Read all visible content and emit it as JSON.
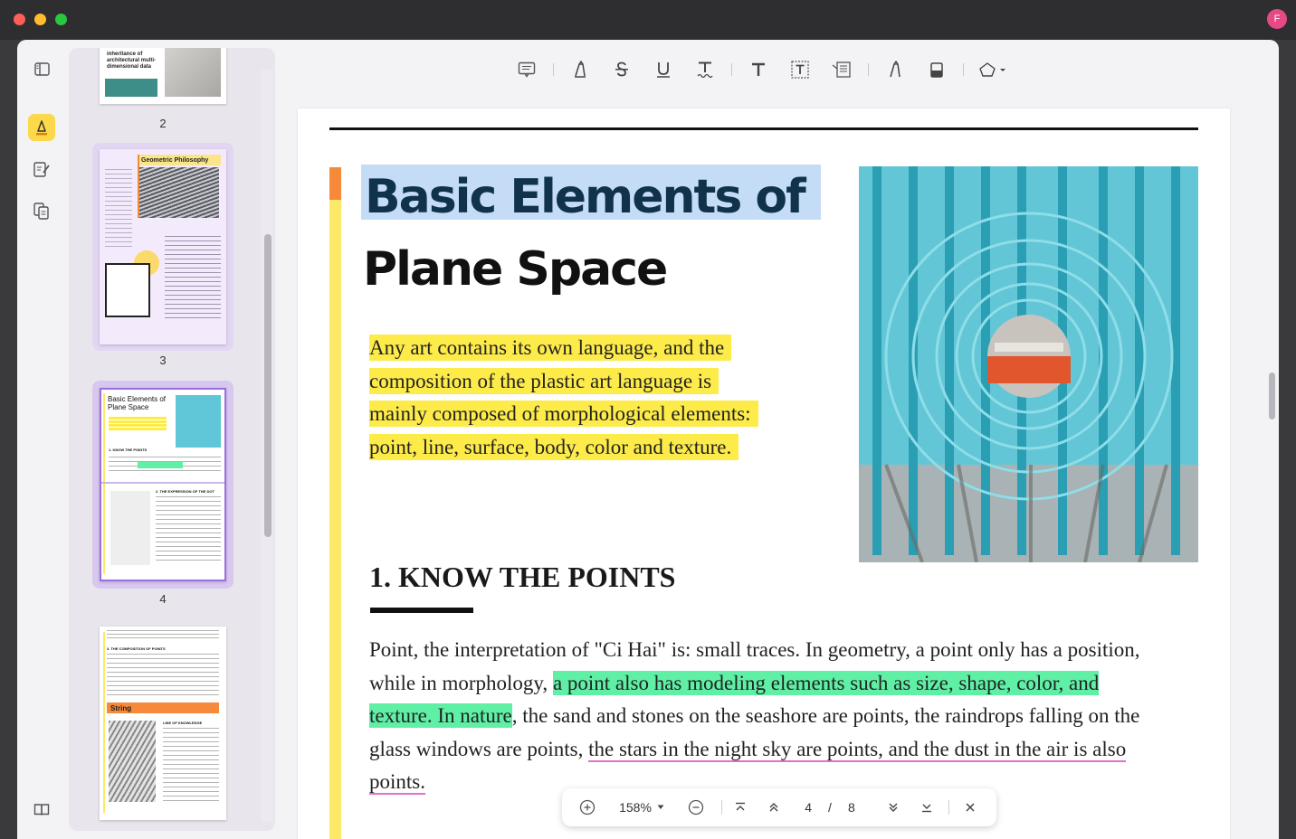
{
  "window": {
    "avatar_letter": "F"
  },
  "rail": {
    "icons": [
      "sidebar-toggle-icon",
      "highlighter-icon",
      "edit-pages-icon",
      "organize-pages-icon",
      "book-icon"
    ]
  },
  "thumbnails": {
    "pages": [
      {
        "number": "2",
        "caption": "inheritance of architectural multi-dimensional data"
      },
      {
        "number": "3",
        "title": "Geometric Philosophy"
      },
      {
        "number": "4",
        "title": "Basic Elements of Plane Space",
        "sub_heading": "1. KNOW THE POINTS",
        "sub_heading2": "2. THE EXPRESSION OF THE DOT"
      },
      {
        "number": "",
        "heading": "3. THE COMPOSITION OF POINTS",
        "label": "String",
        "sub_heading": "LINE OF KNOWLEDGE"
      }
    ]
  },
  "toolbar": {
    "tools": [
      "comment-icon",
      "highlight-icon",
      "strikethrough-icon",
      "underline-icon",
      "squiggly-icon",
      "text-icon",
      "textbox-icon",
      "text-callout-icon",
      "pencil-icon",
      "eraser-icon",
      "shape-icon"
    ]
  },
  "document": {
    "title_line1": "Basic Elements of",
    "title_line2": "Plane Space",
    "intro_lines": [
      "Any art contains its own language, and the",
      "composition of the plastic art language is",
      "mainly composed of morphological elements:",
      "point, line, surface, body, color and texture."
    ],
    "section_heading": "1. KNOW THE POINTS",
    "body": {
      "part1": "Point, the interpretation of \"Ci Hai\" is: small traces. In geometry, a point only has a position, while in morphology, ",
      "highlight": "a point also has modeling elements such as size, shape, color, and texture. In nature",
      "part2": ", the sand and stones on the seashore are points, the raindrops falling on the glass windows are points, ",
      "underlined": "the stars in the night sky are points, and the dust in the air is also points."
    }
  },
  "zoombar": {
    "zoom_level": "158%",
    "current_page": "4",
    "page_separator": "/",
    "total_pages": "8"
  },
  "colors": {
    "highlight_yellow": "#fdeb4a",
    "highlight_green": "#5ff0a6",
    "selection_blue": "#c5dcf7",
    "underline_pink": "#e070c8",
    "accent_orange": "#f68a3a"
  }
}
